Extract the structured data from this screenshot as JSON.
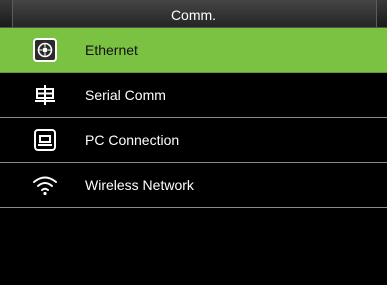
{
  "header": {
    "title": "Comm."
  },
  "menu": {
    "selected_index": 0,
    "items": [
      {
        "label": "Ethernet",
        "icon": "ethernet-icon"
      },
      {
        "label": "Serial Comm",
        "icon": "serial-comm-icon"
      },
      {
        "label": "PC Connection",
        "icon": "pc-connection-icon"
      },
      {
        "label": "Wireless Network",
        "icon": "wifi-icon"
      }
    ]
  },
  "colors": {
    "selected_bg": "#7cc242",
    "background": "#000000"
  }
}
